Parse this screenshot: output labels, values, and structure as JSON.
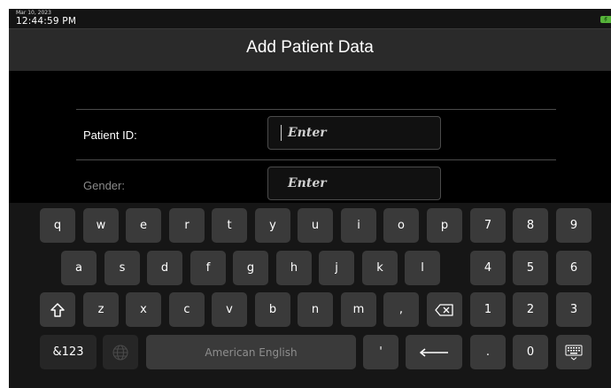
{
  "status": {
    "date": "Mar 10, 2023",
    "time": "12:44:59 PM"
  },
  "header": {
    "title": "Add Patient Data"
  },
  "form": {
    "fields": [
      {
        "label": "Patient ID:",
        "placeholder": "Enter"
      },
      {
        "label": "Gender:",
        "placeholder": "Enter"
      }
    ]
  },
  "keyboard": {
    "row1": [
      "q",
      "w",
      "e",
      "r",
      "t",
      "y",
      "u",
      "i",
      "o",
      "p"
    ],
    "row2": [
      "a",
      "s",
      "d",
      "f",
      "g",
      "h",
      "j",
      "k",
      "l"
    ],
    "row3": [
      "z",
      "x",
      "c",
      "v",
      "b",
      "n",
      "m",
      ","
    ],
    "numpad": [
      "7",
      "8",
      "9",
      "4",
      "5",
      "6",
      "1",
      "2",
      "3",
      ".",
      "0"
    ],
    "symbols_label": "&123",
    "space_label": "American English",
    "apostrophe": "'",
    "icons": [
      "shift-icon",
      "backspace-icon",
      "globe-icon",
      "enter-icon",
      "keyboard-hide-icon"
    ]
  },
  "colors": {
    "screen_bg": "#000000",
    "header_bg": "#2a2a2a",
    "key_bg": "#3a3a3a",
    "battery": "#56b33a"
  }
}
